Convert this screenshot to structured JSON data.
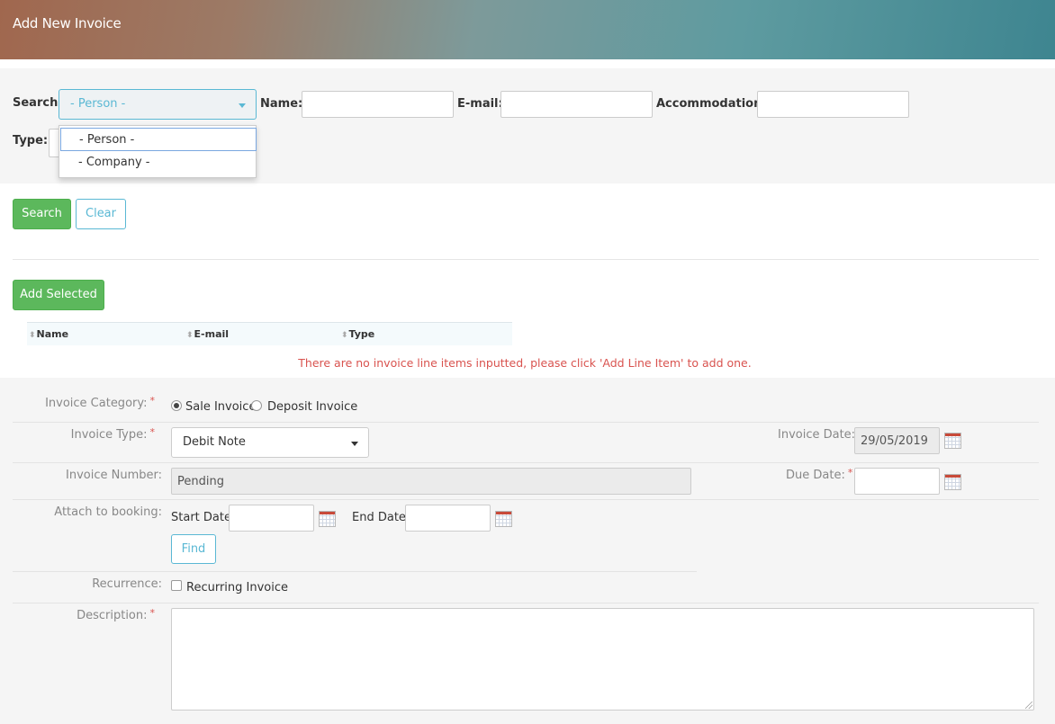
{
  "header": {
    "title": "Add New Invoice"
  },
  "search": {
    "search_label": "Search:",
    "search_value": "- Person -",
    "options": [
      "- Person -",
      "- Company -"
    ],
    "name_label": "Name:",
    "email_label": "E-mail:",
    "accommodation_label": "Accommodation:",
    "type_label": "Type:",
    "search_button": "Search",
    "clear_button": "Clear"
  },
  "results": {
    "add_selected_button": "Add Selected",
    "columns": [
      "Name",
      "E-mail",
      "Type"
    ],
    "message": "There are no invoice line items inputted, please click 'Add Line Item' to add one."
  },
  "form": {
    "category_label": "Invoice Category:",
    "category_options": [
      "Sale Invoice",
      "Deposit Invoice"
    ],
    "category_selected": "Sale Invoice",
    "type_label": "Invoice Type:",
    "type_value": "Debit Note",
    "invoice_date_label": "Invoice Date:",
    "invoice_date_value": "29/05/2019",
    "number_label": "Invoice Number:",
    "number_value": "Pending",
    "due_date_label": "Due Date:",
    "attach_label": "Attach to booking:",
    "start_date_label": "Start Date:",
    "end_date_label": "End Date:",
    "find_button": "Find",
    "recurrence_label": "Recurrence:",
    "recurring_label": "Recurring Invoice",
    "description_label": "Description:",
    "required_mark": "*"
  },
  "colors": {
    "accent": "#5ab8d4",
    "success": "#5cb85c",
    "danger": "#d9534f"
  }
}
